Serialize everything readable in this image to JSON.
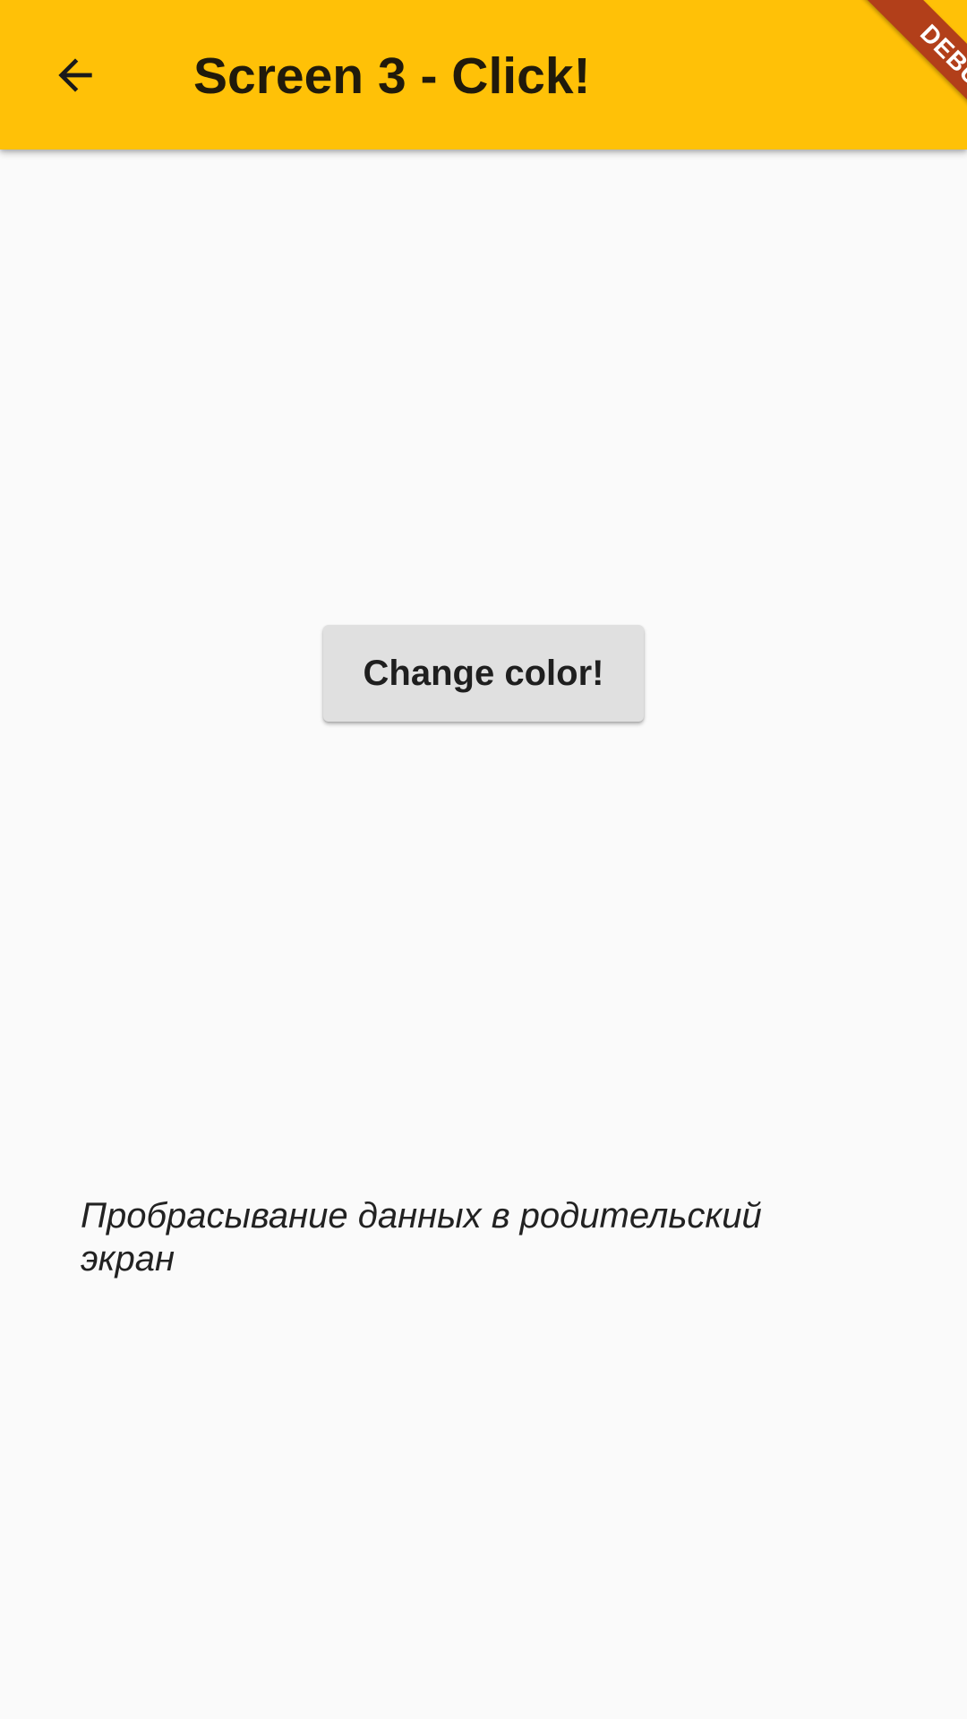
{
  "app_bar": {
    "title": "Screen 3 - Click!",
    "background_color": "#FFC107",
    "back_icon": "arrow-back-icon"
  },
  "debug_banner": {
    "label": "DEBUG",
    "color": "#B23F1A"
  },
  "main": {
    "button_label": "Change color!",
    "caption": "Пробрасывание данных в родительский экран"
  }
}
